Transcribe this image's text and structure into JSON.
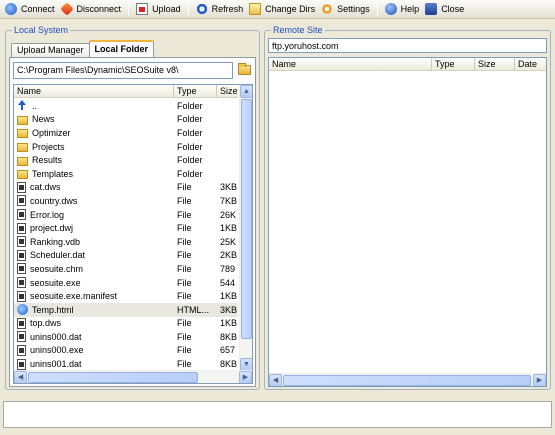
{
  "toolbar": {
    "items": [
      {
        "label": "Connect",
        "icon": "connect-icon"
      },
      {
        "label": "Disconnect",
        "icon": "disconnect-icon"
      },
      {
        "label": "Upload",
        "icon": "upload-icon"
      },
      {
        "label": "Refresh",
        "icon": "refresh-icon"
      },
      {
        "label": "Change Dirs",
        "icon": "change-dirs-icon"
      },
      {
        "label": "Settings",
        "icon": "settings-icon"
      },
      {
        "label": "Help",
        "icon": "help-icon"
      },
      {
        "label": "Close",
        "icon": "close-icon"
      }
    ]
  },
  "local": {
    "title": "Local System",
    "tabs": [
      {
        "label": "Upload Manager",
        "active": false
      },
      {
        "label": "Local Folder",
        "active": true
      }
    ],
    "path": "C:\\Program Files\\Dynamic\\SEOSuite v8\\",
    "columns": [
      "Name",
      "Type",
      "Size"
    ],
    "files": [
      {
        "name": "..",
        "type": "Folder",
        "size": "",
        "icon": "up"
      },
      {
        "name": "News",
        "type": "Folder",
        "size": "",
        "icon": "folder"
      },
      {
        "name": "Optimizer",
        "type": "Folder",
        "size": "",
        "icon": "folder"
      },
      {
        "name": "Projects",
        "type": "Folder",
        "size": "",
        "icon": "folder"
      },
      {
        "name": "Results",
        "type": "Folder",
        "size": "",
        "icon": "folder"
      },
      {
        "name": "Templates",
        "type": "Folder",
        "size": "",
        "icon": "folder"
      },
      {
        "name": "cat.dws",
        "type": "File",
        "size": "3KB",
        "icon": "file"
      },
      {
        "name": "country.dws",
        "type": "File",
        "size": "7KB",
        "icon": "file"
      },
      {
        "name": "Error.log",
        "type": "File",
        "size": "26K",
        "icon": "file"
      },
      {
        "name": "project.dwj",
        "type": "File",
        "size": "1KB",
        "icon": "file"
      },
      {
        "name": "Ranking.vdb",
        "type": "File",
        "size": "25K",
        "icon": "file"
      },
      {
        "name": "Scheduler.dat",
        "type": "File",
        "size": "2KB",
        "icon": "file"
      },
      {
        "name": "seosuite.chm",
        "type": "File",
        "size": "789",
        "icon": "file"
      },
      {
        "name": "seosuite.exe",
        "type": "File",
        "size": "544",
        "icon": "file"
      },
      {
        "name": "seosuite.exe.manifest",
        "type": "File",
        "size": "1KB",
        "icon": "file"
      },
      {
        "name": "Temp.html",
        "type": "HTML...",
        "size": "3KB",
        "icon": "html",
        "selected": true
      },
      {
        "name": "top.dws",
        "type": "File",
        "size": "1KB",
        "icon": "file"
      },
      {
        "name": "unins000.dat",
        "type": "File",
        "size": "8KB",
        "icon": "file"
      },
      {
        "name": "unins000.exe",
        "type": "File",
        "size": "657",
        "icon": "file"
      },
      {
        "name": "unins001.dat",
        "type": "File",
        "size": "8KB",
        "icon": "file"
      }
    ]
  },
  "remote": {
    "title": "Remote Site",
    "address": "ftp.yoruhost.com",
    "columns": [
      "Name",
      "Type",
      "Size",
      "Date"
    ]
  },
  "status": {
    "text": ""
  }
}
